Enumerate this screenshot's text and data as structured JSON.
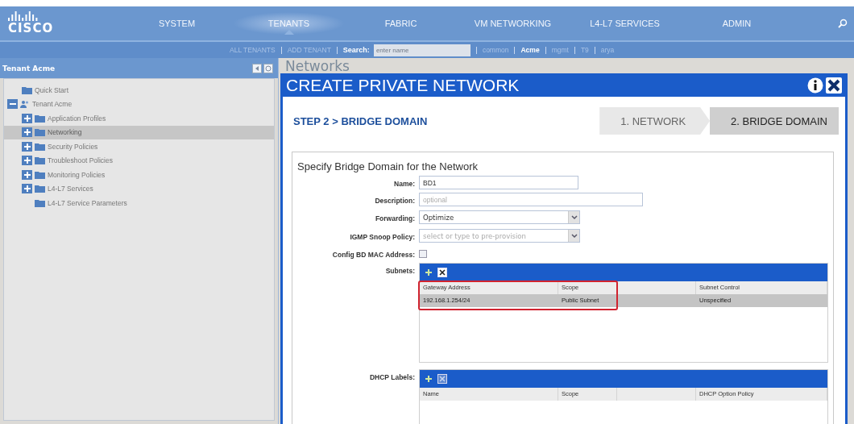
{
  "nav": {
    "logo": "CISCO",
    "tabs": [
      {
        "label": "SYSTEM",
        "selected": false
      },
      {
        "label": "TENANTS",
        "selected": true
      },
      {
        "label": "FABRIC",
        "selected": false
      },
      {
        "label": "VM NETWORKING",
        "selected": false
      },
      {
        "label": "L4-L7 SERVICES",
        "selected": false
      },
      {
        "label": "ADMIN",
        "selected": false
      }
    ]
  },
  "subnav": {
    "actions": [
      "ALL TENANTS",
      "ADD TENANT"
    ],
    "search_label": "Search:",
    "search_placeholder": "enter name",
    "tenants": [
      {
        "label": "common",
        "selected": false
      },
      {
        "label": "Acme",
        "selected": true
      },
      {
        "label": "mgmt",
        "selected": false
      },
      {
        "label": "T9",
        "selected": false
      },
      {
        "label": "arya",
        "selected": false
      }
    ]
  },
  "sidebar": {
    "title": "Tenant Acme",
    "items": [
      {
        "label": "Quick Start",
        "kind": "folder",
        "selected": false
      },
      {
        "label": "Tenant Acme",
        "kind": "tenant",
        "expanded": true,
        "selected": false,
        "children": [
          {
            "label": "Application Profiles",
            "kind": "folder",
            "expanded": false,
            "selected": false
          },
          {
            "label": "Networking",
            "kind": "folder",
            "expanded": false,
            "selected": true
          },
          {
            "label": "Security Policies",
            "kind": "folder",
            "expanded": false,
            "selected": false
          },
          {
            "label": "Troubleshoot Policies",
            "kind": "folder",
            "expanded": false,
            "selected": false
          },
          {
            "label": "Monitoring Policies",
            "kind": "folder",
            "expanded": false,
            "selected": false
          },
          {
            "label": "L4-L7 Services",
            "kind": "folder",
            "expanded": false,
            "selected": false
          },
          {
            "label": "L4-L7 Service Parameters",
            "kind": "folder",
            "selected": false
          }
        ]
      }
    ]
  },
  "page_title": "Networks",
  "dialog": {
    "title": "CREATE PRIVATE NETWORK",
    "step_title": "STEP 2 > BRIDGE DOMAIN",
    "steps": [
      {
        "label": "1. NETWORK",
        "selected": false
      },
      {
        "label": "2. BRIDGE DOMAIN",
        "selected": true
      }
    ],
    "form": {
      "heading": "Specify Bridge Domain for the Network",
      "fields": [
        {
          "kind": "text",
          "label": "Name:",
          "value": "BD1",
          "wide": false
        },
        {
          "kind": "text",
          "label": "Description:",
          "placeholder": "optional",
          "wide": true
        },
        {
          "kind": "select",
          "label": "Forwarding:",
          "value": "Optimize"
        },
        {
          "kind": "select",
          "label": "IGMP Snoop Policy:",
          "placeholder": "select or type to pre-provision"
        },
        {
          "kind": "checkbox",
          "label": "Config BD MAC Address:",
          "checked": false
        },
        {
          "kind": "table",
          "label": "Subnets:",
          "delete_disabled": false,
          "outlined": true,
          "columns": [
            {
              "label": "Gateway Address"
            },
            {
              "label": "Scope"
            },
            {},
            {
              "label": "Subnet Control"
            }
          ],
          "rows": [
            {
              "cells": [
                "192.168.1.254/24",
                "Public Subnet",
                null,
                "Unspecified"
              ],
              "selected": true
            }
          ]
        },
        {
          "kind": "table",
          "label": "DHCP Labels:",
          "delete_disabled": true,
          "outlined": false,
          "columns": [
            {
              "label": "Name"
            },
            {
              "label": "Scope"
            },
            {},
            {
              "label": "DHCP Option Policy"
            }
          ]
        }
      ]
    }
  }
}
